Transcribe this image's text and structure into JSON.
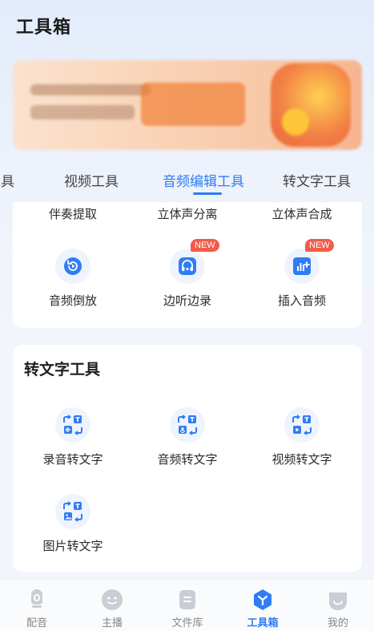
{
  "page": {
    "title": "工具箱"
  },
  "colors": {
    "accent": "#2f7cf6",
    "badge": "#f45b4a",
    "icon_bg": "#eef3fe"
  },
  "tabs": [
    {
      "label": "工具"
    },
    {
      "label": "视频工具"
    },
    {
      "label": "音频编辑工具",
      "active": true
    },
    {
      "label": "转文字工具"
    }
  ],
  "audio_edit": {
    "cut_row": [
      "伴奏提取",
      "立体声分离",
      "立体声合成"
    ],
    "items": [
      {
        "label": "音频倒放",
        "icon": "audio-reverse-icon"
      },
      {
        "label": "边听边录",
        "icon": "listen-record-icon",
        "badge": "NEW"
      },
      {
        "label": "插入音频",
        "icon": "insert-audio-icon",
        "badge": "NEW"
      }
    ]
  },
  "text_tools": {
    "title": "转文字工具",
    "items": [
      {
        "label": "录音转文字",
        "icon": "record-to-text-icon"
      },
      {
        "label": "音频转文字",
        "icon": "audio-to-text-icon"
      },
      {
        "label": "视频转文字",
        "icon": "video-to-text-icon"
      },
      {
        "label": "图片转文字",
        "icon": "image-to-text-icon"
      }
    ]
  },
  "bottom_nav": [
    {
      "label": "配音",
      "icon": "dubbing-icon"
    },
    {
      "label": "主播",
      "icon": "anchor-icon"
    },
    {
      "label": "文件库",
      "icon": "file-library-icon"
    },
    {
      "label": "工具箱",
      "icon": "toolbox-icon",
      "active": true
    },
    {
      "label": "我的",
      "icon": "profile-icon"
    }
  ]
}
